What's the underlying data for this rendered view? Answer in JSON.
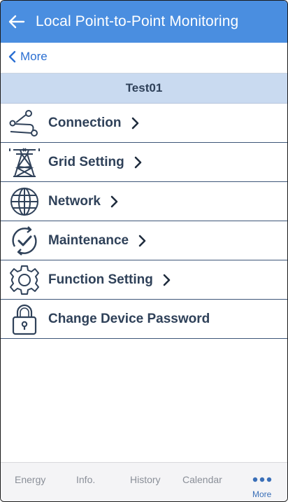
{
  "header": {
    "title": "Local Point-to-Point Monitoring",
    "back_icon": "arrow-left-icon",
    "background_color": "#4a8ee0"
  },
  "subnav": {
    "back_label": "More",
    "back_icon": "chevron-left-icon",
    "link_color": "#2b6fd2"
  },
  "device": {
    "name": "Test01",
    "bar_color": "#c9daf0"
  },
  "menu": {
    "items": [
      {
        "label": "Connection",
        "icon": "connection-route-icon",
        "has_chevron": true
      },
      {
        "label": "Grid Setting",
        "icon": "transmission-tower-icon",
        "has_chevron": true
      },
      {
        "label": "Network",
        "icon": "globe-icon",
        "has_chevron": true
      },
      {
        "label": "Maintenance",
        "icon": "refresh-check-icon",
        "has_chevron": true
      },
      {
        "label": "Function Setting",
        "icon": "gear-icon",
        "has_chevron": true
      },
      {
        "label": "Change Device Password",
        "icon": "lock-icon",
        "has_chevron": false
      }
    ]
  },
  "tabbar": {
    "tabs": [
      {
        "label": "Energy"
      },
      {
        "label": "Info."
      },
      {
        "label": "History"
      },
      {
        "label": "Calendar"
      },
      {
        "label": "More",
        "icon": "more-dots-icon",
        "active": true
      }
    ],
    "active_color": "#3a6fb8",
    "inactive_color": "#8a8f98"
  }
}
